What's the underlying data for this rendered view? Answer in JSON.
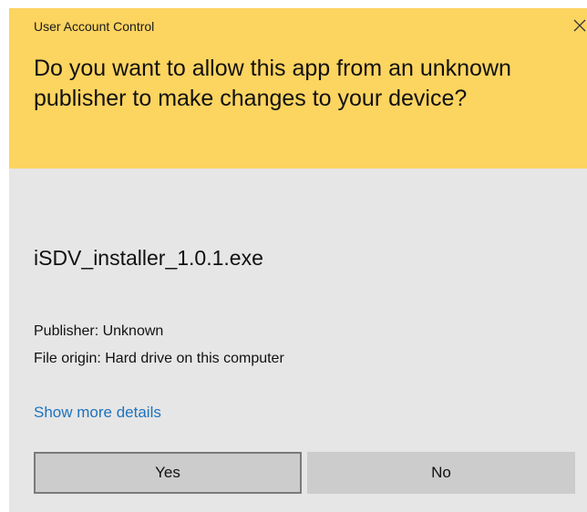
{
  "dialog": {
    "window_title": "User Account Control",
    "close_icon": "close-icon",
    "question": "Do you want to allow this app from an unknown publisher to make changes to your device?",
    "app_name": "iSDV_installer_1.0.1.exe",
    "publisher": "Publisher: Unknown",
    "file_origin": "File origin: Hard drive on this computer",
    "details_link": "Show more details",
    "yes_label": "Yes",
    "no_label": "No"
  },
  "colors": {
    "header_background": "#fcd460",
    "body_background": "#e6e6e6",
    "link": "#1e73be",
    "button_background": "#cccccc",
    "focused_button_border": "#7a7a7a"
  }
}
